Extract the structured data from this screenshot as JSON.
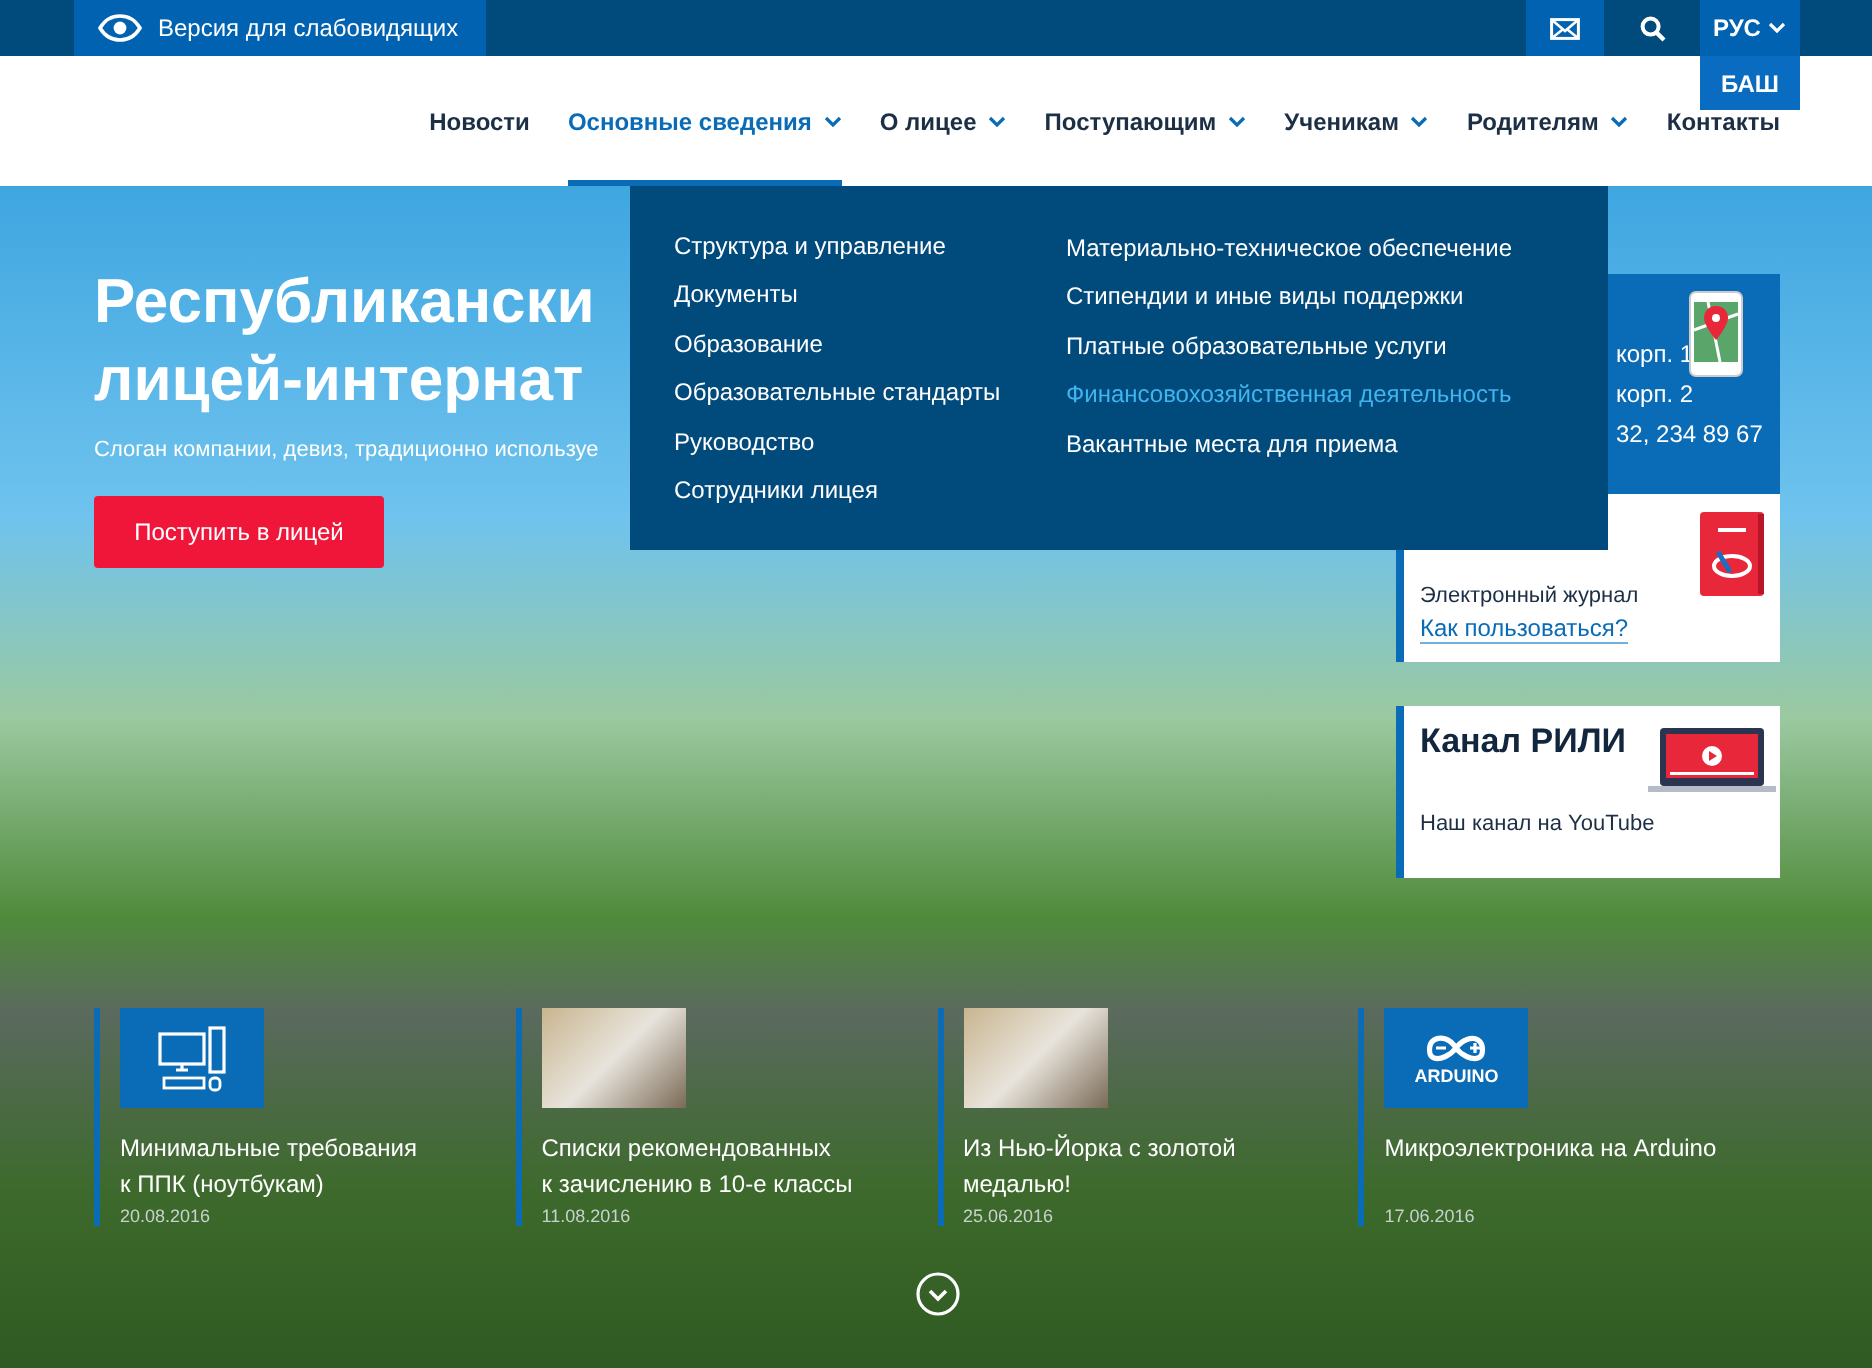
{
  "accessibility_link": "Версия для слабовидящих",
  "languages": [
    {
      "label": "РУС",
      "selected": true
    },
    {
      "label": "БАШ",
      "selected": false
    }
  ],
  "nav": [
    {
      "label": "Новости",
      "has_submenu": false,
      "selected": false
    },
    {
      "label": "Основные сведения",
      "has_submenu": true,
      "selected": true
    },
    {
      "label": "О лицее",
      "has_submenu": true,
      "selected": false
    },
    {
      "label": "Поступающим",
      "has_submenu": true,
      "selected": false
    },
    {
      "label": "Ученикам",
      "has_submenu": true,
      "selected": false
    },
    {
      "label": "Родителям",
      "has_submenu": true,
      "selected": false
    },
    {
      "label": "Контакты",
      "has_submenu": false,
      "selected": false
    }
  ],
  "submenu": {
    "columns": [
      {
        "items": [
          {
            "label": "Структура и управление",
            "selected": false
          },
          {
            "label": "Документы",
            "selected": false
          },
          {
            "label": "Образование",
            "selected": false
          },
          {
            "label": "Образовательные стандарты",
            "selected": false
          },
          {
            "label": "Руководство",
            "selected": false
          },
          {
            "label": "Сотрудники лицея",
            "selected": false
          }
        ]
      },
      {
        "items": [
          {
            "label": "Материально-техническое обеспечение",
            "selected": false
          },
          {
            "label": "Стипендии и иные виды поддержки",
            "selected": false
          },
          {
            "label": "Платные образовательные услуги",
            "selected": false
          },
          {
            "label": "Финансовохозяйственная деятельность",
            "selected": true
          },
          {
            "label": "Вакантные места для приема",
            "selected": false
          }
        ]
      }
    ]
  },
  "hero": {
    "title_lines": [
      "Республикански",
      "лицей-интернат"
    ],
    "slogan": "Слоган компании, девиз, традиционно используе",
    "button": "Поступить в лицей"
  },
  "contacts_card": {
    "lines": [
      "корп. 1",
      "корп. 2",
      "32, 234 89 67"
    ]
  },
  "journal_card": {
    "title": "Электронный журнал",
    "link": "Как пользоваться?"
  },
  "channel_card": {
    "title": "Канал РИЛИ",
    "subtitle": "Наш канал на YouTube"
  },
  "news": [
    {
      "kind": "computer",
      "title_lines": [
        "Минимальные требования",
        "к ППК (ноутбукам)"
      ],
      "date": "20.08.2016"
    },
    {
      "kind": "photo",
      "title_lines": [
        "Списки рекомендованных",
        "к зачислению в 10-е классы"
      ],
      "date": "11.08.2016"
    },
    {
      "kind": "photo",
      "title_lines": [
        "Из Нью-Йорка с золотой",
        "медалью!"
      ],
      "date": "25.06.2016"
    },
    {
      "kind": "logo",
      "logo_text": "ARDUINO",
      "title_lines": [
        "Микроэлектроника на Arduino"
      ],
      "date": "17.06.2016"
    }
  ]
}
